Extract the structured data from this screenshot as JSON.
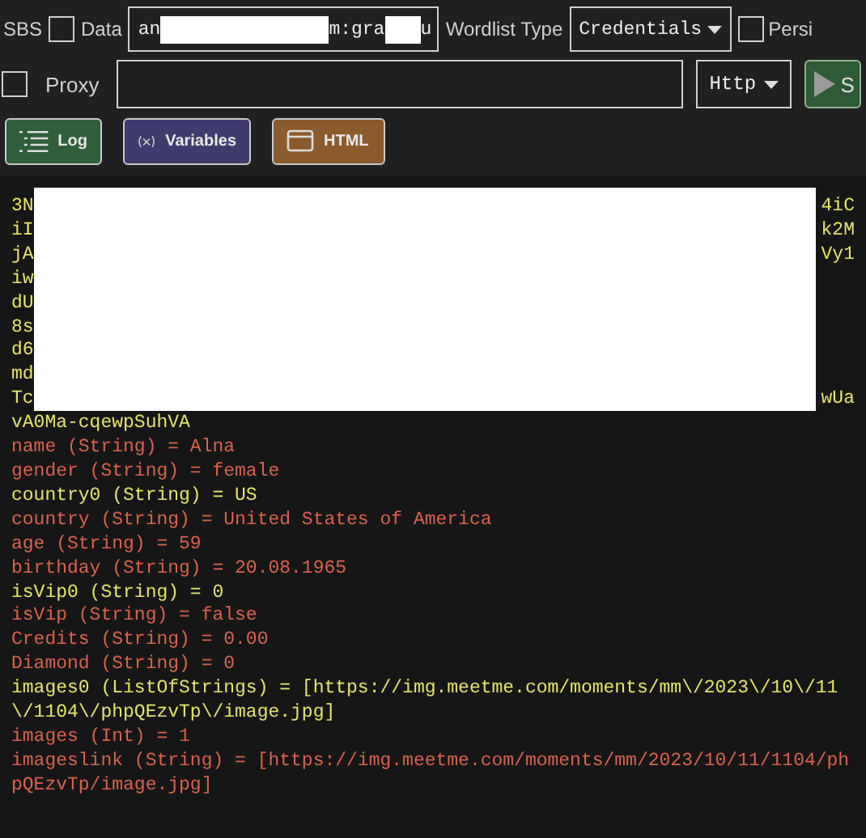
{
  "toolbar": {
    "sbs_label": "SBS",
    "data": {
      "label": "Data",
      "checked": false,
      "value_parts": [
        {
          "kind": "text",
          "text": "an"
        },
        {
          "kind": "redacted"
        },
        {
          "kind": "text",
          "text": "m:gra"
        },
        {
          "kind": "redacted"
        },
        {
          "kind": "text",
          "text": "u"
        }
      ]
    },
    "wordlist_label": "Wordlist Type",
    "wordlist_type": "Credentials",
    "persist": {
      "label": "Persi",
      "checked": false
    }
  },
  "proxy_row": {
    "checked": false,
    "label": "Proxy",
    "protocol": "Http",
    "start_label": "S"
  },
  "view_buttons": [
    {
      "label": "Log",
      "kind": "log"
    },
    {
      "label": "Variables",
      "kind": "variables"
    },
    {
      "label": "HTML",
      "kind": "html"
    }
  ],
  "log": {
    "redacted_lines": [
      {
        "left": "3N",
        "right": "4iC"
      },
      {
        "left": "iI",
        "right": "k2M"
      },
      {
        "left": "jA",
        "right": "Vy1"
      },
      {
        "left": "iw"
      },
      {
        "left": "dU"
      },
      {
        "left": "8s"
      },
      {
        "left": "d6"
      },
      {
        "left": "md"
      },
      {
        "left": "Tc",
        "right": "wUa"
      }
    ],
    "lines": [
      {
        "text": "vA0Ma-cqewpSuhVA",
        "color": "#e3e36c"
      },
      {
        "text": "name (String) = Alna",
        "color": "#d9624f"
      },
      {
        "text": "gender (String) = female",
        "color": "#d9624f"
      },
      {
        "text": "country0 (String) = US",
        "color": "#e3e36c"
      },
      {
        "text": "country (String) = United States of America",
        "color": "#d9624f"
      },
      {
        "text": "age (String) = 59",
        "color": "#d9624f"
      },
      {
        "text": "birthday (String) = 20.08.1965",
        "color": "#d9624f"
      },
      {
        "text": "isVip0 (String) = 0",
        "color": "#e3e36c"
      },
      {
        "text": "isVip (String) = false",
        "color": "#d9624f"
      },
      {
        "text": "Credits (String) = 0.00",
        "color": "#d9624f"
      },
      {
        "text": "Diamond (String) = 0",
        "color": "#d9624f"
      },
      {
        "text": "images0 (ListOfStrings) = [https://img.meetme.com/moments/mm\\/2023\\/10\\/11\\/1104\\/phpQEzvTp\\/image.jpg]",
        "color": "#e3e36c"
      },
      {
        "text": "images (Int) = 1",
        "color": "#d9624f"
      },
      {
        "text": "imageslink (String) = [https://img.meetme.com/moments/mm/2023/10/11/1104/phpQEzvTp/image.jpg]",
        "color": "#d9624f"
      }
    ]
  }
}
